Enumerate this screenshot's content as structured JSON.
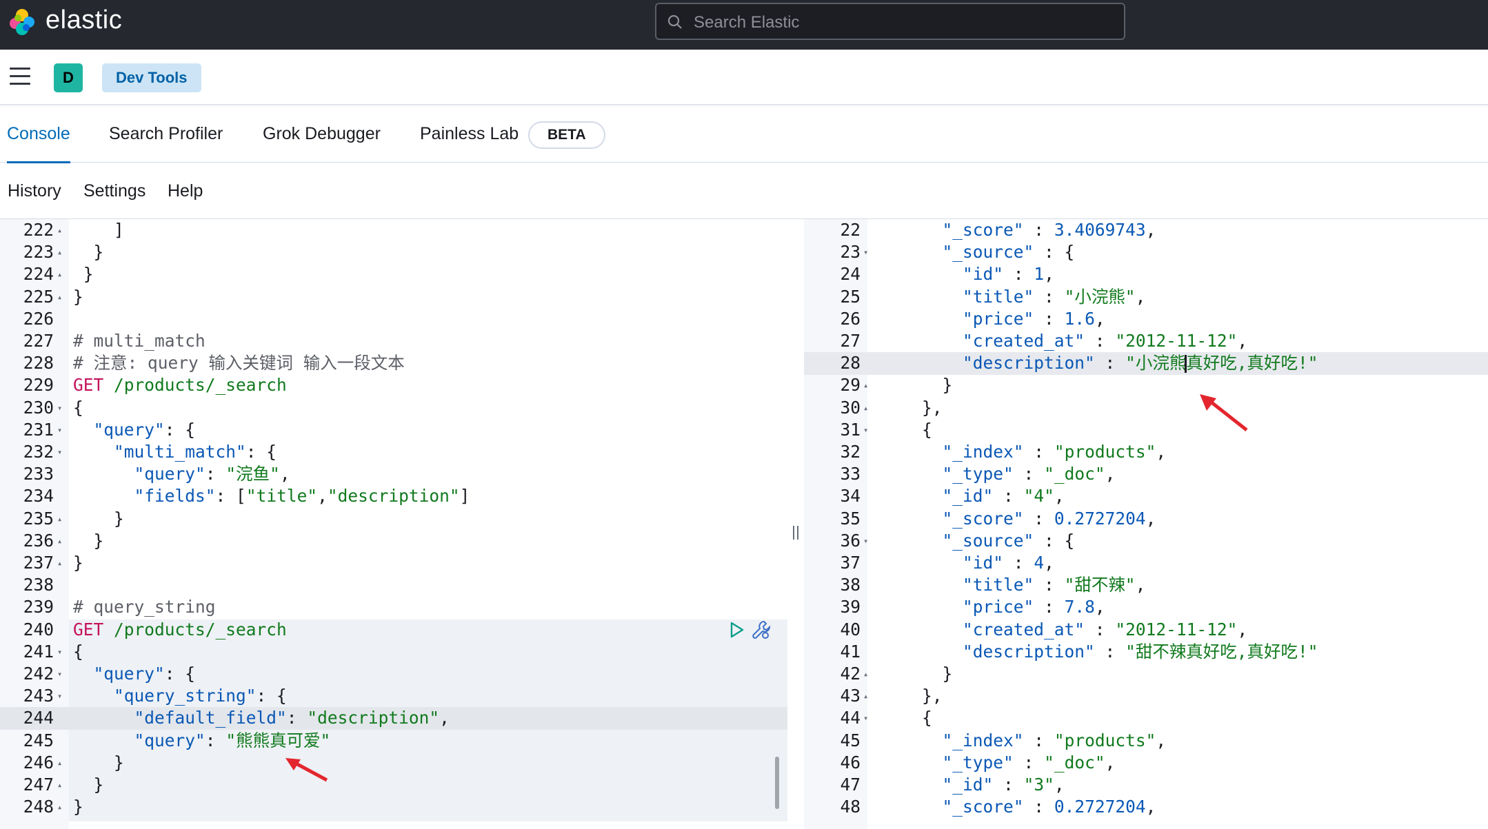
{
  "header": {
    "brand": "elastic",
    "search_placeholder": "Search Elastic"
  },
  "nav": {
    "avatar_letter": "D",
    "breadcrumb": "Dev Tools"
  },
  "tabs": [
    {
      "label": "Console",
      "active": true
    },
    {
      "label": "Search Profiler",
      "active": false
    },
    {
      "label": "Grok Debugger",
      "active": false
    },
    {
      "label": "Painless Lab",
      "active": false
    }
  ],
  "beta_badge": "BETA",
  "menu": {
    "history": "History",
    "settings": "Settings",
    "help": "Help"
  },
  "request_editor": {
    "lines": [
      {
        "n": "222",
        "fold": "▴",
        "code": "    ]"
      },
      {
        "n": "223",
        "fold": "▴",
        "code": "  }"
      },
      {
        "n": "224",
        "fold": "▴",
        "code": " }"
      },
      {
        "n": "225",
        "fold": "▴",
        "code": "}"
      },
      {
        "n": "226",
        "fold": "",
        "code": ""
      },
      {
        "n": "227",
        "fold": "",
        "code": "# multi_match"
      },
      {
        "n": "228",
        "fold": "",
        "code": "# 注意: query 输入关键词 输入一段文本"
      },
      {
        "n": "229",
        "fold": "",
        "code": "GET /products/_search"
      },
      {
        "n": "230",
        "fold": "▾",
        "code": "{"
      },
      {
        "n": "231",
        "fold": "▾",
        "code": "  \"query\": {"
      },
      {
        "n": "232",
        "fold": "▾",
        "code": "    \"multi_match\": {"
      },
      {
        "n": "233",
        "fold": "",
        "code": "      \"query\": \"浣鱼\","
      },
      {
        "n": "234",
        "fold": "",
        "code": "      \"fields\": [\"title\",\"description\"]"
      },
      {
        "n": "235",
        "fold": "▴",
        "code": "    }"
      },
      {
        "n": "236",
        "fold": "▴",
        "code": "  }"
      },
      {
        "n": "237",
        "fold": "▴",
        "code": "}"
      },
      {
        "n": "238",
        "fold": "",
        "code": ""
      },
      {
        "n": "239",
        "fold": "",
        "code": "# query_string"
      },
      {
        "n": "240",
        "fold": "",
        "code": "GET /products/_search"
      },
      {
        "n": "241",
        "fold": "▾",
        "code": "{"
      },
      {
        "n": "242",
        "fold": "▾",
        "code": "  \"query\": {"
      },
      {
        "n": "243",
        "fold": "▾",
        "code": "    \"query_string\": {"
      },
      {
        "n": "244",
        "fold": "",
        "code": "      \"default_field\": \"description\","
      },
      {
        "n": "245",
        "fold": "",
        "code": "      \"query\": \"熊熊真可爱\""
      },
      {
        "n": "246",
        "fold": "▴",
        "code": "    }"
      },
      {
        "n": "247",
        "fold": "▴",
        "code": "  }"
      },
      {
        "n": "248",
        "fold": "▴",
        "code": "}"
      }
    ]
  },
  "response_editor": {
    "lines": [
      {
        "n": "22",
        "fold": "",
        "code": "      \"_score\" : 3.4069743,"
      },
      {
        "n": "23",
        "fold": "▾",
        "code": "      \"_source\" : {"
      },
      {
        "n": "24",
        "fold": "",
        "code": "        \"id\" : 1,"
      },
      {
        "n": "25",
        "fold": "",
        "code": "        \"title\" : \"小浣熊\","
      },
      {
        "n": "26",
        "fold": "",
        "code": "        \"price\" : 1.6,"
      },
      {
        "n": "27",
        "fold": "",
        "code": "        \"created_at\" : \"2012-11-12\","
      },
      {
        "n": "28",
        "fold": "",
        "code": "        \"description\" : \"小浣熊真好吃,真好吃!\""
      },
      {
        "n": "29",
        "fold": "▴",
        "code": "      }"
      },
      {
        "n": "30",
        "fold": "▴",
        "code": "    },"
      },
      {
        "n": "31",
        "fold": "▾",
        "code": "    {"
      },
      {
        "n": "32",
        "fold": "",
        "code": "      \"_index\" : \"products\","
      },
      {
        "n": "33",
        "fold": "",
        "code": "      \"_type\" : \"_doc\","
      },
      {
        "n": "34",
        "fold": "",
        "code": "      \"_id\" : \"4\","
      },
      {
        "n": "35",
        "fold": "",
        "code": "      \"_score\" : 0.2727204,"
      },
      {
        "n": "36",
        "fold": "▾",
        "code": "      \"_source\" : {"
      },
      {
        "n": "37",
        "fold": "",
        "code": "        \"id\" : 4,"
      },
      {
        "n": "38",
        "fold": "",
        "code": "        \"title\" : \"甜不辣\","
      },
      {
        "n": "39",
        "fold": "",
        "code": "        \"price\" : 7.8,"
      },
      {
        "n": "40",
        "fold": "",
        "code": "        \"created_at\" : \"2012-11-12\","
      },
      {
        "n": "41",
        "fold": "",
        "code": "        \"description\" : \"甜不辣真好吃,真好吃!\""
      },
      {
        "n": "42",
        "fold": "▴",
        "code": "      }"
      },
      {
        "n": "43",
        "fold": "▴",
        "code": "    },"
      },
      {
        "n": "44",
        "fold": "▾",
        "code": "    {"
      },
      {
        "n": "45",
        "fold": "",
        "code": "      \"_index\" : \"products\","
      },
      {
        "n": "46",
        "fold": "",
        "code": "      \"_type\" : \"_doc\","
      },
      {
        "n": "47",
        "fold": "",
        "code": "      \"_id\" : \"3\","
      },
      {
        "n": "48",
        "fold": "",
        "code": "      \"_score\" : 0.2727204,"
      }
    ]
  },
  "icons": {
    "logo": "elastic-logo-icon",
    "search": "search-icon",
    "menu": "hamburger-menu-icon",
    "run": "play-icon",
    "wrench": "wrench-icon"
  },
  "colors": {
    "header_bg": "#25282f",
    "accent": "#006bb8",
    "string": "#117a1e",
    "key": "#0a58b5",
    "method": "#c4125b",
    "annotation_arrow": "#e3262e"
  }
}
